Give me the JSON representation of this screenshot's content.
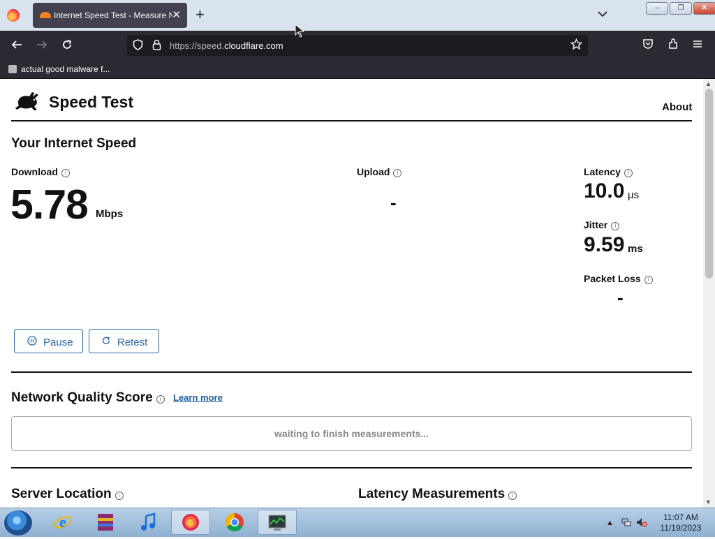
{
  "browser": {
    "tab_title": "Internet Speed Test - Measure Network Performance | Cloudflare",
    "tab_close": "✕",
    "new_tab": "+",
    "url_prefix": "https://speed.",
    "url_domain": "cloudflare.com",
    "bookmark": "actual good malware f...",
    "window_controls": [
      "–",
      "❐",
      "✕"
    ]
  },
  "page": {
    "site_title": "Speed Test",
    "about": "About",
    "section_title": "Your Internet Speed",
    "download": {
      "label": "Download",
      "value": "5.78",
      "unit": "Mbps"
    },
    "upload": {
      "label": "Upload",
      "value": "-"
    },
    "latency": {
      "label": "Latency",
      "value": "10.0",
      "unit": "µs"
    },
    "jitter": {
      "label": "Jitter",
      "value": "9.59",
      "unit": "ms"
    },
    "packet_loss": {
      "label": "Packet Loss",
      "value": "-"
    },
    "pause_label": "Pause",
    "retest_label": "Retest",
    "nq_title": "Network Quality Score",
    "learn_more": "Learn more",
    "nq_status": "waiting to finish measurements...",
    "server_location": "Server Location",
    "latency_measurements": "Latency Measurements",
    "info_glyph": "i"
  },
  "taskbar": {
    "time": "11:07 AM",
    "date": "11/19/2023"
  },
  "icons": [
    "firefox-icon",
    "cloudflare-favicon",
    "back-icon",
    "forward-icon",
    "reload-icon",
    "shield-icon",
    "lock-icon",
    "star-icon",
    "pocket-icon",
    "extensions-icon",
    "menu-icon",
    "rabbit-logo-icon",
    "pause-icon",
    "retest-icon",
    "info-icon",
    "windows-start-icon",
    "ie-icon",
    "winrar-icon",
    "itunes-icon",
    "chrome-icon",
    "task-manager-icon",
    "speaker-muted-icon",
    "network-icon"
  ]
}
